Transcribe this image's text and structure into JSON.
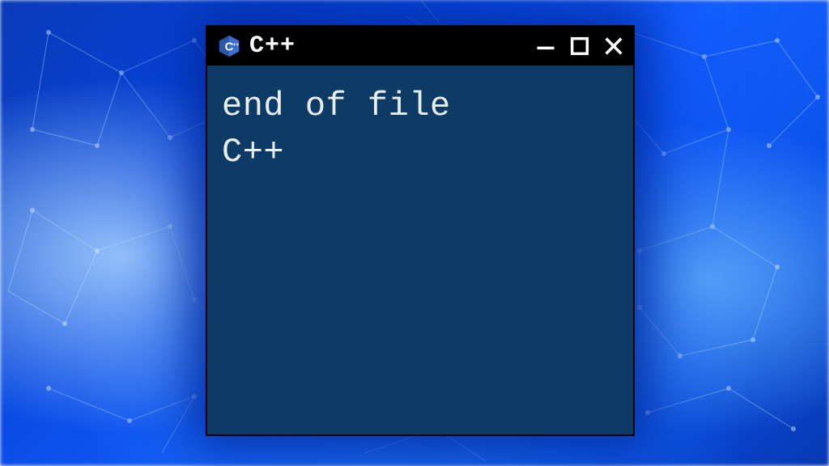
{
  "window": {
    "title": "C++",
    "icon_name": "cpp-logo-icon"
  },
  "content": {
    "lines": [
      "end of file",
      "C++"
    ]
  },
  "colors": {
    "window_bg": "#0d3b66",
    "titlebar_bg": "#000000",
    "text": "#e8eef2",
    "accent_blue": "#1560ff"
  }
}
